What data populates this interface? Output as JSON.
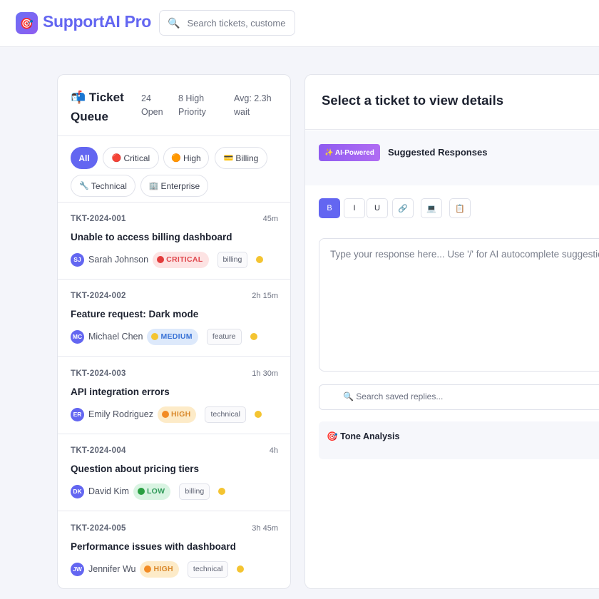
{
  "header": {
    "logo_icon": "🎯",
    "app_title": "SupportAI Pro",
    "search_icon": "🔍",
    "search_placeholder": "Search tickets, customers..."
  },
  "queue": {
    "title_icon": "📬",
    "title": "Ticket Queue",
    "stats": {
      "open": "24 Open",
      "high_priority": "8 High Priority",
      "avg_wait": "Avg: 2.3h wait"
    },
    "filters": [
      {
        "icon": "",
        "label": "All",
        "active": true
      },
      {
        "icon": "🔴",
        "label": "Critical"
      },
      {
        "icon": "🟠",
        "label": "High"
      },
      {
        "icon": "💳",
        "label": "Billing"
      },
      {
        "icon": "🔧",
        "label": "Technical"
      },
      {
        "icon": "🏢",
        "label": "Enterprise"
      }
    ],
    "tickets": [
      {
        "id": "TKT-2024-001",
        "time": "45m",
        "subject": "Unable to access billing dashboard",
        "initials": "SJ",
        "customer": "Sarah Johnson",
        "priority": "CRITICAL",
        "tag": "billing"
      },
      {
        "id": "TKT-2024-002",
        "time": "2h 15m",
        "subject": "Feature request: Dark mode",
        "initials": "MC",
        "customer": "Michael Chen",
        "priority": "MEDIUM",
        "tag": "feature"
      },
      {
        "id": "TKT-2024-003",
        "time": "1h 30m",
        "subject": "API integration errors",
        "initials": "ER",
        "customer": "Emily Rodriguez",
        "priority": "HIGH",
        "tag": "technical"
      },
      {
        "id": "TKT-2024-004",
        "time": "4h",
        "subject": "Question about pricing tiers",
        "initials": "DK",
        "customer": "David Kim",
        "priority": "LOW",
        "tag": "billing"
      },
      {
        "id": "TKT-2024-005",
        "time": "3h 45m",
        "subject": "Performance issues with dashboard",
        "initials": "JW",
        "customer": "Jennifer Wu",
        "priority": "HIGH",
        "tag": "technical"
      }
    ]
  },
  "detail": {
    "title": "Select a ticket to view details",
    "ai_badge": "✨ AI-Powered",
    "suggested_title": "Suggested Responses",
    "toolbar": {
      "bold": "B",
      "italic": "I",
      "underline": "U",
      "link": "🔗",
      "code": "💻",
      "template": "📋"
    },
    "editor_placeholder": "Type your response here... Use '/' for AI autocomplete suggestions",
    "saved_search_icon": "🔍",
    "saved_placeholder": "Search saved replies...",
    "tone_icon": "🎯",
    "tone_label": "Tone Analysis"
  },
  "colors": {
    "accent": "#6366f1",
    "critical": "#e0484e",
    "medium": "#3a73d6",
    "high": "#d9892c",
    "low": "#2f9a58"
  }
}
